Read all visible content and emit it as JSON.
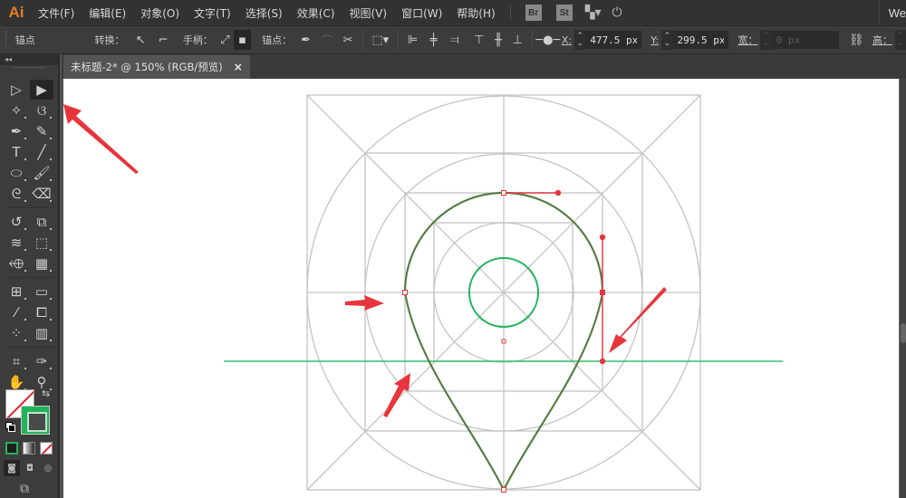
{
  "app": {
    "logo": "Ai",
    "menu": [
      "文件(F)",
      "编辑(E)",
      "对象(O)",
      "文字(T)",
      "选择(S)",
      "效果(C)",
      "视图(V)",
      "窗口(W)",
      "帮助(H)"
    ],
    "bridge_badge": "Br",
    "stock_badge": "St",
    "workspace_label": "We"
  },
  "control_bar": {
    "selection_label": "锚点",
    "convert_label": "转换：",
    "handles_label": "手柄：",
    "anchors_label": "锚点：",
    "x_label": "X:",
    "x_value": "477.5 px",
    "y_label": "Y:",
    "y_value": "299.5 px",
    "width_label": "宽：",
    "width_value": "0 px",
    "height_label": "高："
  },
  "document": {
    "tab_title": "未标题-2* @ 150% (RGB/预览)",
    "close_glyph": "×"
  },
  "tools": {
    "panel_toggle": "◂◂",
    "items": [
      {
        "name": "selection-tool",
        "glyph": "▷"
      },
      {
        "name": "direct-selection-tool",
        "glyph": "▶",
        "active": true
      },
      {
        "name": "magic-wand-tool",
        "glyph": "✧"
      },
      {
        "name": "lasso-tool",
        "glyph": "ଓ"
      },
      {
        "name": "pen-tool",
        "glyph": "✒"
      },
      {
        "name": "curvature-tool",
        "glyph": "✎"
      },
      {
        "name": "type-tool",
        "glyph": "T"
      },
      {
        "name": "line-segment-tool",
        "glyph": "╱"
      },
      {
        "name": "ellipse-tool",
        "glyph": "⬭"
      },
      {
        "name": "paintbrush-tool",
        "glyph": "🖌"
      },
      {
        "name": "shaper-tool",
        "glyph": "ᘓ"
      },
      {
        "name": "eraser-tool",
        "glyph": "⌫"
      },
      {
        "name": "rotate-tool",
        "glyph": "↺"
      },
      {
        "name": "scale-tool",
        "glyph": "⧉"
      },
      {
        "name": "width-tool",
        "glyph": "≋"
      },
      {
        "name": "free-transform-tool",
        "glyph": "⬚"
      },
      {
        "name": "shape-builder-tool",
        "glyph": "⬲"
      },
      {
        "name": "perspective-grid-tool",
        "glyph": "▦"
      },
      {
        "name": "mesh-tool",
        "glyph": "⊞"
      },
      {
        "name": "gradient-tool",
        "glyph": "▭"
      },
      {
        "name": "eyedropper-tool",
        "glyph": "⁄"
      },
      {
        "name": "blend-tool",
        "glyph": "⧠"
      },
      {
        "name": "symbol-sprayer-tool",
        "glyph": "⁘"
      },
      {
        "name": "column-graph-tool",
        "glyph": "▥"
      },
      {
        "name": "artboard-tool",
        "glyph": "⌗"
      },
      {
        "name": "slice-tool",
        "glyph": "✑"
      },
      {
        "name": "hand-tool",
        "glyph": "✋"
      },
      {
        "name": "zoom-tool",
        "glyph": "⚲"
      }
    ],
    "swap_glyph": "⇆",
    "draw_modes": [
      "◙",
      "◘",
      "◎"
    ],
    "screen_mode_glyph": "⧉"
  },
  "colors": {
    "fill": "none",
    "stroke": "#22b25a",
    "accent_red": "#e8343c",
    "guide_green": "#2fbf6a",
    "path_stroke": "#7a6a3a",
    "grid_gray": "#c4c4c4"
  },
  "annotations": {
    "arrow_count": 4,
    "description": "Red arrows pointing at the direct selection tool, left anchor, lower-left curve, and right handle"
  }
}
